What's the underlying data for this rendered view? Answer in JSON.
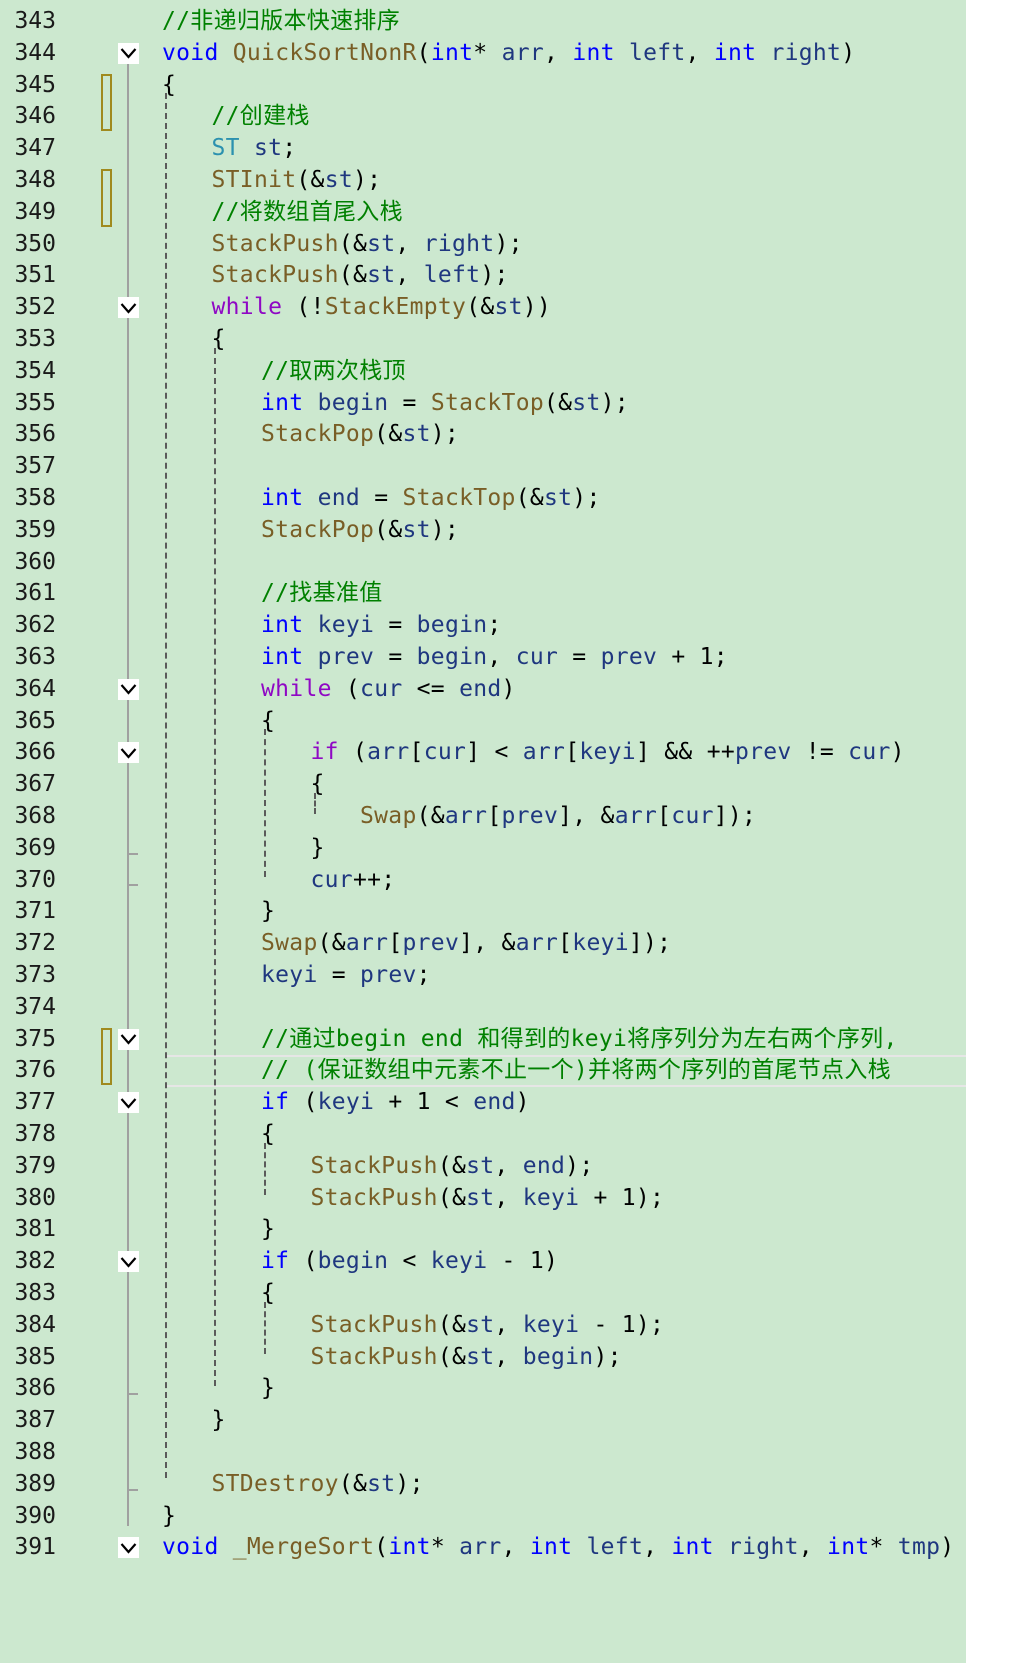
{
  "editor": {
    "lines": [
      {
        "n": "343",
        "indent": 0,
        "tokens": [
          [
            "cmt",
            "//非递归版本快速排序"
          ]
        ]
      },
      {
        "n": "344",
        "indent": 0,
        "fold": true,
        "tokens": [
          [
            "kw",
            "void"
          ],
          [
            "op",
            " "
          ],
          [
            "fn",
            "QuickSortNonR"
          ],
          [
            "op",
            "("
          ],
          [
            "kw",
            "int"
          ],
          [
            "op",
            "* "
          ],
          [
            "var",
            "arr"
          ],
          [
            "op",
            ", "
          ],
          [
            "kw",
            "int"
          ],
          [
            "op",
            " "
          ],
          [
            "var",
            "left"
          ],
          [
            "op",
            ", "
          ],
          [
            "kw",
            "int"
          ],
          [
            "op",
            " "
          ],
          [
            "var",
            "right"
          ],
          [
            "op",
            ")"
          ]
        ]
      },
      {
        "n": "345",
        "indent": 0,
        "tokens": [
          [
            "op",
            "{"
          ]
        ]
      },
      {
        "n": "346",
        "indent": 1,
        "tokens": [
          [
            "cmt",
            "//创建栈"
          ]
        ]
      },
      {
        "n": "347",
        "indent": 1,
        "tokens": [
          [
            "type",
            "ST"
          ],
          [
            "op",
            " "
          ],
          [
            "var",
            "st"
          ],
          [
            "op",
            ";"
          ]
        ]
      },
      {
        "n": "348",
        "indent": 1,
        "tokens": [
          [
            "fn",
            "STInit"
          ],
          [
            "op",
            "(&"
          ],
          [
            "var",
            "st"
          ],
          [
            "op",
            ");"
          ]
        ]
      },
      {
        "n": "349",
        "indent": 1,
        "tokens": [
          [
            "cmt",
            "//将数组首尾入栈"
          ]
        ]
      },
      {
        "n": "350",
        "indent": 1,
        "tokens": [
          [
            "fn",
            "StackPush"
          ],
          [
            "op",
            "(&"
          ],
          [
            "var",
            "st"
          ],
          [
            "op",
            ", "
          ],
          [
            "var",
            "right"
          ],
          [
            "op",
            ");"
          ]
        ]
      },
      {
        "n": "351",
        "indent": 1,
        "tokens": [
          [
            "fn",
            "StackPush"
          ],
          [
            "op",
            "(&"
          ],
          [
            "var",
            "st"
          ],
          [
            "op",
            ", "
          ],
          [
            "var",
            "left"
          ],
          [
            "op",
            ");"
          ]
        ]
      },
      {
        "n": "352",
        "indent": 1,
        "fold": true,
        "tokens": [
          [
            "kw2",
            "while"
          ],
          [
            "op",
            " (!"
          ],
          [
            "fn",
            "StackEmpty"
          ],
          [
            "op",
            "(&"
          ],
          [
            "var",
            "st"
          ],
          [
            "op",
            "))"
          ]
        ]
      },
      {
        "n": "353",
        "indent": 1,
        "tokens": [
          [
            "op",
            "{"
          ]
        ]
      },
      {
        "n": "354",
        "indent": 2,
        "tokens": [
          [
            "cmt",
            "//取两次栈顶"
          ]
        ]
      },
      {
        "n": "355",
        "indent": 2,
        "tokens": [
          [
            "kw",
            "int"
          ],
          [
            "op",
            " "
          ],
          [
            "var",
            "begin"
          ],
          [
            "op",
            " = "
          ],
          [
            "fn",
            "StackTop"
          ],
          [
            "op",
            "(&"
          ],
          [
            "var",
            "st"
          ],
          [
            "op",
            ");"
          ]
        ]
      },
      {
        "n": "356",
        "indent": 2,
        "tokens": [
          [
            "fn",
            "StackPop"
          ],
          [
            "op",
            "(&"
          ],
          [
            "var",
            "st"
          ],
          [
            "op",
            ");"
          ]
        ]
      },
      {
        "n": "357",
        "indent": 2,
        "tokens": []
      },
      {
        "n": "358",
        "indent": 2,
        "tokens": [
          [
            "kw",
            "int"
          ],
          [
            "op",
            " "
          ],
          [
            "var",
            "end"
          ],
          [
            "op",
            " = "
          ],
          [
            "fn",
            "StackTop"
          ],
          [
            "op",
            "(&"
          ],
          [
            "var",
            "st"
          ],
          [
            "op",
            ");"
          ]
        ]
      },
      {
        "n": "359",
        "indent": 2,
        "tokens": [
          [
            "fn",
            "StackPop"
          ],
          [
            "op",
            "(&"
          ],
          [
            "var",
            "st"
          ],
          [
            "op",
            ");"
          ]
        ]
      },
      {
        "n": "360",
        "indent": 2,
        "tokens": []
      },
      {
        "n": "361",
        "indent": 2,
        "tokens": [
          [
            "cmt",
            "//找基准值"
          ]
        ]
      },
      {
        "n": "362",
        "indent": 2,
        "tokens": [
          [
            "kw",
            "int"
          ],
          [
            "op",
            " "
          ],
          [
            "var",
            "keyi"
          ],
          [
            "op",
            " = "
          ],
          [
            "var",
            "begin"
          ],
          [
            "op",
            ";"
          ]
        ]
      },
      {
        "n": "363",
        "indent": 2,
        "tokens": [
          [
            "kw",
            "int"
          ],
          [
            "op",
            " "
          ],
          [
            "var",
            "prev"
          ],
          [
            "op",
            " = "
          ],
          [
            "var",
            "begin"
          ],
          [
            "op",
            ", "
          ],
          [
            "var",
            "cur"
          ],
          [
            "op",
            " = "
          ],
          [
            "var",
            "prev"
          ],
          [
            "op",
            " + 1;"
          ]
        ]
      },
      {
        "n": "364",
        "indent": 2,
        "fold": true,
        "tokens": [
          [
            "kw2",
            "while"
          ],
          [
            "op",
            " ("
          ],
          [
            "var",
            "cur"
          ],
          [
            "op",
            " <= "
          ],
          [
            "var",
            "end"
          ],
          [
            "op",
            ")"
          ]
        ]
      },
      {
        "n": "365",
        "indent": 2,
        "tokens": [
          [
            "op",
            "{"
          ]
        ]
      },
      {
        "n": "366",
        "indent": 3,
        "fold": true,
        "tokens": [
          [
            "kw2",
            "if"
          ],
          [
            "op",
            " ("
          ],
          [
            "var",
            "arr"
          ],
          [
            "op",
            "["
          ],
          [
            "var",
            "cur"
          ],
          [
            "op",
            "] < "
          ],
          [
            "var",
            "arr"
          ],
          [
            "op",
            "["
          ],
          [
            "var",
            "keyi"
          ],
          [
            "op",
            "] && ++"
          ],
          [
            "var",
            "prev"
          ],
          [
            "op",
            " != "
          ],
          [
            "var",
            "cur"
          ],
          [
            "op",
            ")"
          ]
        ]
      },
      {
        "n": "367",
        "indent": 3,
        "tokens": [
          [
            "op",
            "{"
          ]
        ]
      },
      {
        "n": "368",
        "indent": 4,
        "tokens": [
          [
            "fn",
            "Swap"
          ],
          [
            "op",
            "(&"
          ],
          [
            "var",
            "arr"
          ],
          [
            "op",
            "["
          ],
          [
            "var",
            "prev"
          ],
          [
            "op",
            "], &"
          ],
          [
            "var",
            "arr"
          ],
          [
            "op",
            "["
          ],
          [
            "var",
            "cur"
          ],
          [
            "op",
            "]);"
          ]
        ]
      },
      {
        "n": "369",
        "indent": 3,
        "tokens": [
          [
            "op",
            "}"
          ]
        ]
      },
      {
        "n": "370",
        "indent": 3,
        "tokens": [
          [
            "var",
            "cur"
          ],
          [
            "op",
            "++;"
          ]
        ]
      },
      {
        "n": "371",
        "indent": 2,
        "tokens": [
          [
            "op",
            "}"
          ]
        ]
      },
      {
        "n": "372",
        "indent": 2,
        "tokens": [
          [
            "fn",
            "Swap"
          ],
          [
            "op",
            "(&"
          ],
          [
            "var",
            "arr"
          ],
          [
            "op",
            "["
          ],
          [
            "var",
            "prev"
          ],
          [
            "op",
            "], &"
          ],
          [
            "var",
            "arr"
          ],
          [
            "op",
            "["
          ],
          [
            "var",
            "keyi"
          ],
          [
            "op",
            "]);"
          ]
        ]
      },
      {
        "n": "373",
        "indent": 2,
        "tokens": [
          [
            "var",
            "keyi"
          ],
          [
            "op",
            " = "
          ],
          [
            "var",
            "prev"
          ],
          [
            "op",
            ";"
          ]
        ]
      },
      {
        "n": "374",
        "indent": 2,
        "tokens": []
      },
      {
        "n": "375",
        "indent": 2,
        "fold": true,
        "tokens": [
          [
            "cmt",
            "//通过begin end 和得到的keyi将序列分为左右两个序列,"
          ]
        ]
      },
      {
        "n": "376",
        "indent": 2,
        "current": true,
        "tokens": [
          [
            "cmt",
            "// (保证数组中元素不止一个)并将两个序列的首尾节点入栈"
          ]
        ]
      },
      {
        "n": "377",
        "indent": 2,
        "fold": true,
        "tokens": [
          [
            "kw",
            "if"
          ],
          [
            "op",
            " ("
          ],
          [
            "var",
            "keyi"
          ],
          [
            "op",
            " + 1 < "
          ],
          [
            "var",
            "end"
          ],
          [
            "op",
            ")"
          ]
        ]
      },
      {
        "n": "378",
        "indent": 2,
        "tokens": [
          [
            "op",
            "{"
          ]
        ]
      },
      {
        "n": "379",
        "indent": 3,
        "tokens": [
          [
            "fn",
            "StackPush"
          ],
          [
            "op",
            "(&"
          ],
          [
            "var",
            "st"
          ],
          [
            "op",
            ", "
          ],
          [
            "var",
            "end"
          ],
          [
            "op",
            ");"
          ]
        ]
      },
      {
        "n": "380",
        "indent": 3,
        "tokens": [
          [
            "fn",
            "StackPush"
          ],
          [
            "op",
            "(&"
          ],
          [
            "var",
            "st"
          ],
          [
            "op",
            ", "
          ],
          [
            "var",
            "keyi"
          ],
          [
            "op",
            " + 1);"
          ]
        ]
      },
      {
        "n": "381",
        "indent": 2,
        "tokens": [
          [
            "op",
            "}"
          ]
        ]
      },
      {
        "n": "382",
        "indent": 2,
        "fold": true,
        "tokens": [
          [
            "kw",
            "if"
          ],
          [
            "op",
            " ("
          ],
          [
            "var",
            "begin"
          ],
          [
            "op",
            " < "
          ],
          [
            "var",
            "keyi"
          ],
          [
            "op",
            " - 1)"
          ]
        ]
      },
      {
        "n": "383",
        "indent": 2,
        "tokens": [
          [
            "op",
            "{"
          ]
        ]
      },
      {
        "n": "384",
        "indent": 3,
        "tokens": [
          [
            "fn",
            "StackPush"
          ],
          [
            "op",
            "(&"
          ],
          [
            "var",
            "st"
          ],
          [
            "op",
            ", "
          ],
          [
            "var",
            "keyi"
          ],
          [
            "op",
            " - 1);"
          ]
        ]
      },
      {
        "n": "385",
        "indent": 3,
        "tokens": [
          [
            "fn",
            "StackPush"
          ],
          [
            "op",
            "(&"
          ],
          [
            "var",
            "st"
          ],
          [
            "op",
            ", "
          ],
          [
            "var",
            "begin"
          ],
          [
            "op",
            ");"
          ]
        ]
      },
      {
        "n": "386",
        "indent": 2,
        "tokens": [
          [
            "op",
            "}"
          ]
        ]
      },
      {
        "n": "387",
        "indent": 1,
        "tokens": [
          [
            "op",
            "}"
          ]
        ]
      },
      {
        "n": "388",
        "indent": 1,
        "tokens": []
      },
      {
        "n": "389",
        "indent": 1,
        "tokens": [
          [
            "fn",
            "STDestroy"
          ],
          [
            "op",
            "(&"
          ],
          [
            "var",
            "st"
          ],
          [
            "op",
            ");"
          ]
        ]
      },
      {
        "n": "390",
        "indent": 0,
        "tokens": [
          [
            "op",
            "}"
          ]
        ]
      },
      {
        "n": "391",
        "indent": 0,
        "fold": true,
        "tokens": [
          [
            "kw",
            "void"
          ],
          [
            "op",
            " "
          ],
          [
            "fn",
            "_MergeSort"
          ],
          [
            "op",
            "("
          ],
          [
            "kw",
            "int"
          ],
          [
            "op",
            "* "
          ],
          [
            "var",
            "arr"
          ],
          [
            "op",
            ", "
          ],
          [
            "kw",
            "int"
          ],
          [
            "op",
            " "
          ],
          [
            "var",
            "left"
          ],
          [
            "op",
            ", "
          ],
          [
            "kw",
            "int"
          ],
          [
            "op",
            " "
          ],
          [
            "var",
            "right"
          ],
          [
            "op",
            ", "
          ],
          [
            "kw",
            "int"
          ],
          [
            "op",
            "* "
          ],
          [
            "var",
            "tmp"
          ],
          [
            "op",
            ")"
          ]
        ]
      }
    ],
    "change_markers": [
      "345-346",
      "348-349",
      "375-376"
    ],
    "fold_icon": "chevron-down-icon",
    "colors": {
      "background": "#cce8cf",
      "comment": "#008000",
      "keyword": "#0000ff",
      "control_keyword": "#8f08c4",
      "function": "#795e26",
      "variable": "#1f377f",
      "type": "#2b91af",
      "change_marker": "#a08a1e"
    }
  }
}
